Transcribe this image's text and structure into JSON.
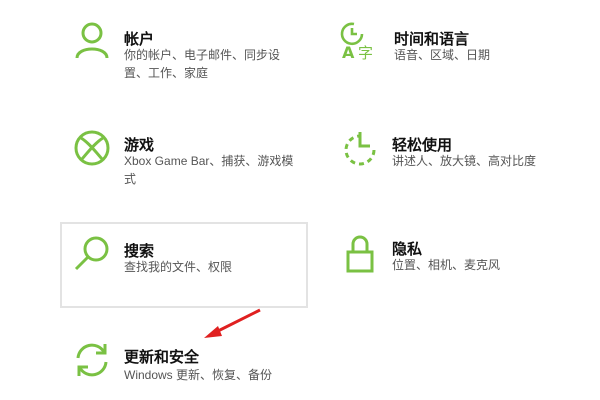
{
  "settings": {
    "tiles": [
      {
        "key": "accounts",
        "title": "帐户",
        "desc": "你的帐户、电子邮件、同步设置、工作、家庭",
        "icon": "person-icon"
      },
      {
        "key": "time",
        "title": "时间和语言",
        "desc": "语音、区域、日期",
        "icon": "time-language-icon"
      },
      {
        "key": "gaming",
        "title": "游戏",
        "desc": "Xbox Game Bar、捕获、游戏模式",
        "icon": "xbox-icon"
      },
      {
        "key": "ease",
        "title": "轻松使用",
        "desc": "讲述人、放大镜、高对比度",
        "icon": "ease-of-access-icon"
      },
      {
        "key": "search",
        "title": "搜索",
        "desc": "查找我的文件、权限",
        "icon": "search-icon"
      },
      {
        "key": "privacy",
        "title": "隐私",
        "desc": "位置、相机、麦克风",
        "icon": "lock-icon"
      },
      {
        "key": "update",
        "title": "更新和安全",
        "desc": "Windows 更新、恢复、备份",
        "icon": "sync-icon"
      }
    ]
  },
  "colors": {
    "accent": "#7ac143",
    "annotation_arrow": "#e02020",
    "hover_border": "#e3e3e3"
  }
}
